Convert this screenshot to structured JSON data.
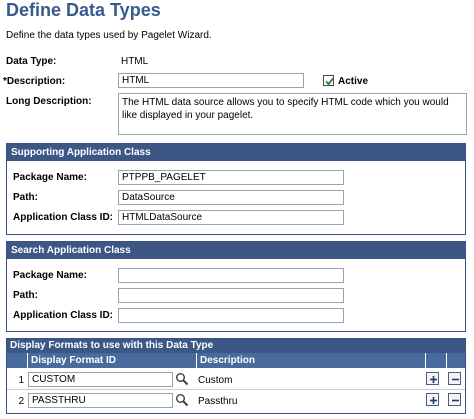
{
  "page": {
    "title": "Define Data Types",
    "subtitle": "Define the data types used by Pagelet Wizard."
  },
  "form": {
    "data_type_label": "Data Type:",
    "data_type_value": "HTML",
    "description_label": "*Description:",
    "description_value": "HTML",
    "active_label": "Active",
    "active_checked": true,
    "long_description_label": "Long Description:",
    "long_description_value": "The HTML data source allows you to specify HTML code which you would like displayed in your pagelet."
  },
  "supporting_class": {
    "header": "Supporting Application Class",
    "package_label": "Package Name:",
    "package_value": "PTPPB_PAGELET",
    "path_label": "Path:",
    "path_value": "DataSource",
    "class_id_label": "Application Class ID:",
    "class_id_value": "HTMLDataSource"
  },
  "search_class": {
    "header": "Search Application Class",
    "package_label": "Package Name:",
    "package_value": "",
    "path_label": "Path:",
    "path_value": "",
    "class_id_label": "Application Class ID:",
    "class_id_value": ""
  },
  "formats_grid": {
    "title": "Display Formats to use with this Data Type",
    "col_format_id": "Display Format ID",
    "col_description": "Description",
    "rows": [
      {
        "num": "1",
        "format_id": "CUSTOM",
        "description": "Custom"
      },
      {
        "num": "2",
        "format_id": "PASSTHRU",
        "description": "Passthru"
      }
    ]
  },
  "icons": {
    "lookup": "magnifier-icon",
    "add": "plus-icon",
    "delete": "minus-icon",
    "check": "checkmark-icon"
  },
  "colors": {
    "title": "#3a5a8f",
    "header_bg": "#3d5785",
    "col_header_bg": "#486a9c",
    "active_check": "#2e7d32"
  }
}
